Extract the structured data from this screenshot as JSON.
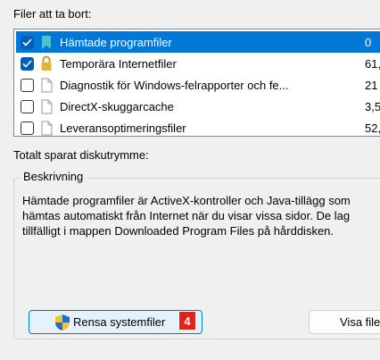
{
  "files_label": "Filer att ta bort:",
  "file_list": [
    {
      "name": "Hämtade programfiler",
      "size": "0",
      "checked": true,
      "selected": true,
      "icon": "folder-icon"
    },
    {
      "name": "Temporära Internetfiler",
      "size": "61,",
      "checked": true,
      "selected": false,
      "icon": "lock-icon"
    },
    {
      "name": "Diagnostik för Windows-felrapporter och fe...",
      "size": "21",
      "checked": false,
      "selected": false,
      "icon": "file-icon"
    },
    {
      "name": "DirectX-skuggarcache",
      "size": "3,5",
      "checked": false,
      "selected": false,
      "icon": "file-icon"
    },
    {
      "name": "Leveransoptimeringsfiler",
      "size": "52,",
      "checked": false,
      "selected": false,
      "icon": "file-icon"
    }
  ],
  "total_label": "Totalt sparat diskutrymme:",
  "description": {
    "title": "Beskrivning",
    "lines": [
      "Hämtade programfiler är ActiveX-kontroller och Java-tillägg som",
      "hämtas automatiskt från Internet när du visar vissa sidor. De lag",
      "tillfälligt i mappen Downloaded Program Files på hårddisken."
    ]
  },
  "buttons": {
    "cleanup_system": "Rensa systemfiler",
    "view_files": "Visa file",
    "badge": "4"
  },
  "colors": {
    "selection": "#0078d7",
    "checkbox": "#005fb8",
    "badge": "#e0221b"
  }
}
